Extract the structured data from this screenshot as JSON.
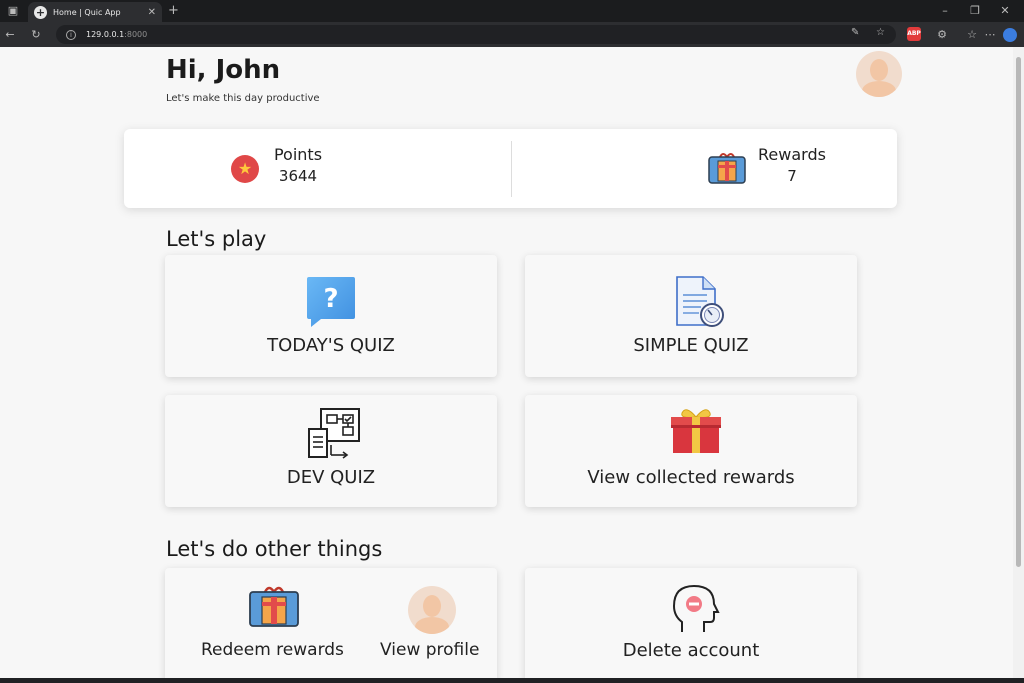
{
  "browser": {
    "tab_title": "Home | Quic App",
    "url_host": "129.0.0.1",
    "url_port": ":8000"
  },
  "header": {
    "greeting": "Hi, John",
    "subtitle": "Let's make this day productive"
  },
  "stats": {
    "points_label": "Points",
    "points_value": "3644",
    "rewards_label": "Rewards",
    "rewards_value": "7"
  },
  "play": {
    "title": "Let's play",
    "cards": [
      {
        "label": "TODAY'S QUIZ",
        "icon": "question-bubble-icon"
      },
      {
        "label": "SIMPLE QUIZ",
        "icon": "document-clock-icon"
      },
      {
        "label": "DEV QUIZ",
        "icon": "flowchart-icon"
      },
      {
        "label": "View collected rewards",
        "icon": "gift-icon"
      }
    ]
  },
  "other": {
    "title": "Let's do other things",
    "redeem_label": "Redeem rewards",
    "profile_label": "View profile",
    "delete_label": "Delete account"
  },
  "colors": {
    "accent_red": "#e04848",
    "star_yellow": "#ffc83d",
    "quiz_blue": "#4aa3ee",
    "gift_red": "#d9363e"
  }
}
